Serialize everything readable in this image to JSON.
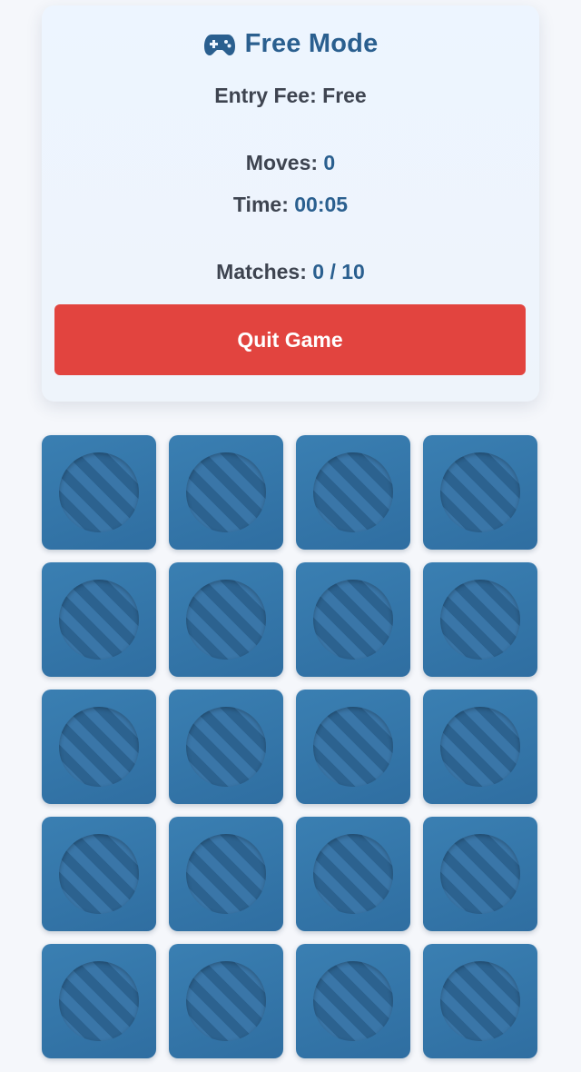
{
  "header": {
    "title": "Free Mode",
    "title_icon": "gamepad-icon",
    "entry_fee_label": "Entry Fee:",
    "entry_fee_value": "Free"
  },
  "stats": {
    "moves_label": "Moves:",
    "moves_value": "0",
    "time_label": "Time:",
    "time_value": "00:05",
    "matches_label": "Matches:",
    "matches_value": "0 / 10"
  },
  "actions": {
    "quit_label": "Quit Game"
  },
  "board": {
    "columns": 4,
    "rows": 5,
    "cards_face_down": 20,
    "card_back_icon": "striped-circle-icon"
  },
  "colors": {
    "accent": "#2a5f8f",
    "quit_button": "#e2443f",
    "card_back": "#3577aa",
    "background": "#f5f7fb"
  }
}
